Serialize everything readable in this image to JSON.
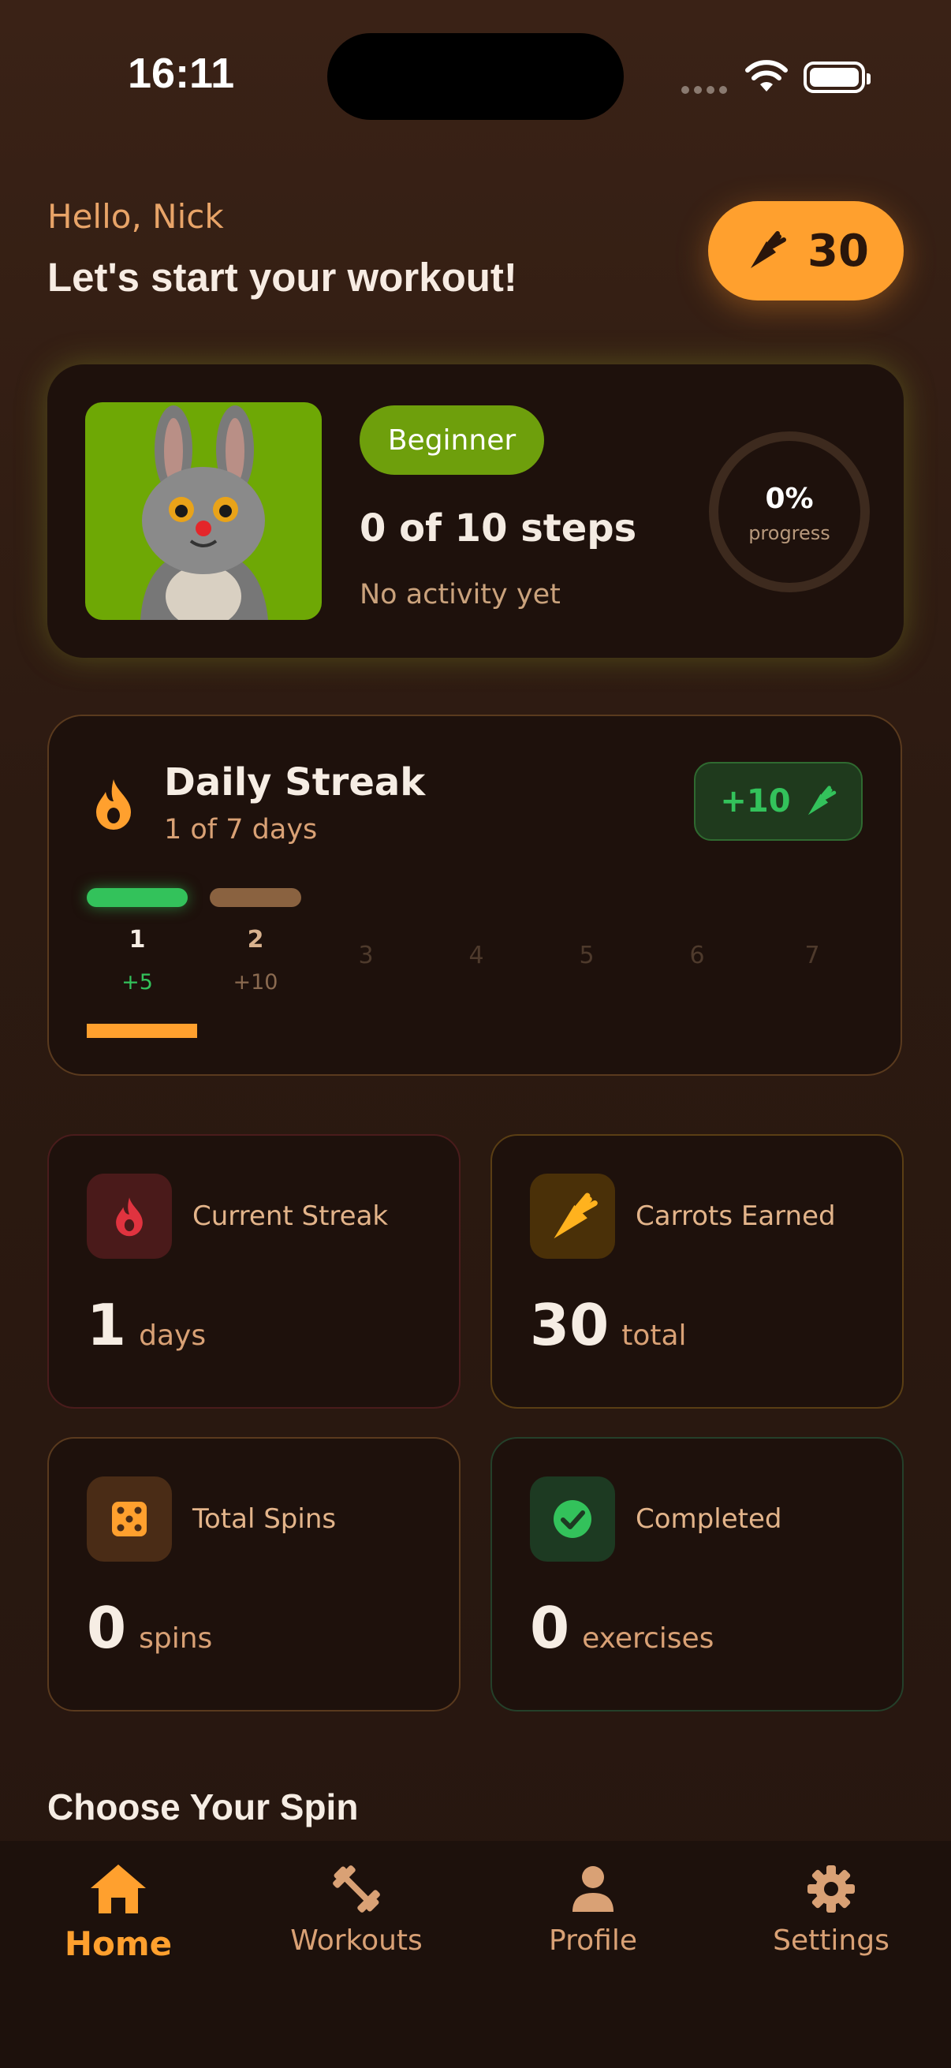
{
  "status_bar": {
    "time": "16:11"
  },
  "header": {
    "greeting": "Hello, Nick",
    "headline": "Let's start your workout!",
    "carrot_balance": "30"
  },
  "level_card": {
    "badge": "Beginner",
    "steps": "0 of 10 steps",
    "activity": "No activity yet",
    "progress_percent": "0%",
    "progress_label": "progress",
    "progress_value": 0
  },
  "streak": {
    "title": "Daily Streak",
    "subtitle": "1 of 7 days",
    "reward": "+10",
    "days": [
      {
        "label": "1",
        "bonus": "+5"
      },
      {
        "label": "2",
        "bonus": "+10"
      },
      {
        "label": "3"
      },
      {
        "label": "4"
      },
      {
        "label": "5"
      },
      {
        "label": "6"
      },
      {
        "label": "7"
      }
    ]
  },
  "stats": [
    {
      "label": "Current Streak",
      "value": "1",
      "unit": "days",
      "icon": "flame-icon"
    },
    {
      "label": "Carrots Earned",
      "value": "30",
      "unit": "total",
      "icon": "carrot-icon"
    },
    {
      "label": "Total Spins",
      "value": "0",
      "unit": "spins",
      "icon": "dice-icon"
    },
    {
      "label": "Completed",
      "value": "0",
      "unit": "exercises",
      "icon": "check-circle-icon"
    }
  ],
  "section_title": "Choose Your Spin",
  "tabs": [
    {
      "label": "Home",
      "icon": "home-icon"
    },
    {
      "label": "Workouts",
      "icon": "dumbbell-icon"
    },
    {
      "label": "Profile",
      "icon": "person-icon"
    },
    {
      "label": "Settings",
      "icon": "gear-icon"
    }
  ],
  "colors": {
    "accent": "#ffa02e",
    "success": "#33c25b",
    "level": "#6e9f0c",
    "background": "#2c1a11",
    "card": "#1e110c"
  }
}
